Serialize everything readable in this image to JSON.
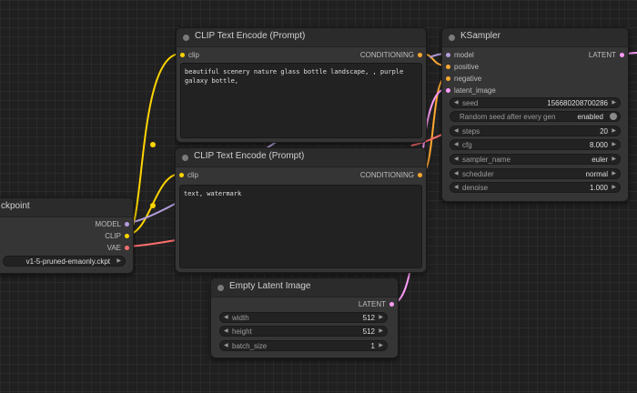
{
  "colors": {
    "clip": "#ffd500",
    "conditioning": "#ffa931",
    "model": "#b39ddb",
    "vae": "#ff6e6e",
    "latent": "#ff9cf9"
  },
  "nodes": {
    "clip_pos": {
      "title": "CLIP Text Encode (Prompt)",
      "input_clip": "clip",
      "output": "CONDITIONING",
      "text": "beautiful scenery nature glass bottle landscape, , purple galaxy bottle,"
    },
    "clip_neg": {
      "title": "CLIP Text Encode (Prompt)",
      "input_clip": "clip",
      "output": "CONDITIONING",
      "text": "text, watermark"
    },
    "checkpoint": {
      "title": "ckpoint",
      "outputs": [
        "MODEL",
        "CLIP",
        "VAE"
      ],
      "ckpt_name": "v1-5-pruned-emaonly.ckpt"
    },
    "ksampler": {
      "title": "KSampler",
      "inputs": [
        "model",
        "positive",
        "negative",
        "latent_image"
      ],
      "output": "LATENT",
      "widgets": {
        "seed": {
          "label": "seed",
          "value": "156680208700286"
        },
        "control": {
          "label": "Random seed after every gen",
          "value": "enabled"
        },
        "steps": {
          "label": "steps",
          "value": "20"
        },
        "cfg": {
          "label": "cfg",
          "value": "8.000"
        },
        "sampler": {
          "label": "sampler_name",
          "value": "euler"
        },
        "scheduler": {
          "label": "scheduler",
          "value": "normal"
        },
        "denoise": {
          "label": "denoise",
          "value": "1.000"
        }
      }
    },
    "latent": {
      "title": "Empty Latent Image",
      "output": "LATENT",
      "widgets": {
        "width": {
          "label": "width",
          "value": "512"
        },
        "height": {
          "label": "height",
          "value": "512"
        },
        "batch_size": {
          "label": "batch_size",
          "value": "1"
        }
      }
    }
  }
}
